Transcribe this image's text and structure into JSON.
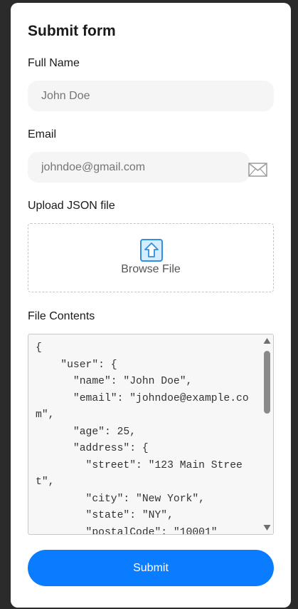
{
  "form": {
    "title": "Submit form",
    "full_name": {
      "label": "Full Name",
      "placeholder": "John Doe"
    },
    "email": {
      "label": "Email",
      "placeholder": "johndoe@gmail.com",
      "icon": "envelope-icon"
    },
    "upload": {
      "label": "Upload JSON file",
      "button_text": "Browse File",
      "icon": "upload-arrow-icon"
    },
    "file_contents": {
      "label": "File Contents",
      "text": "{\n    \"user\": {\n      \"name\": \"John Doe\",\n      \"email\": \"johndoe@example.com\",\n      \"age\": 25,\n      \"address\": {\n        \"street\": \"123 Main Street\",\n        \"city\": \"New York\",\n        \"state\": \"NY\",\n        \"postalCode\": \"10001\""
    },
    "submit_label": "Submit",
    "colors": {
      "accent": "#0a7cff",
      "input_bg": "#f5f5f5",
      "upload_icon": "#2f8fe0"
    }
  }
}
